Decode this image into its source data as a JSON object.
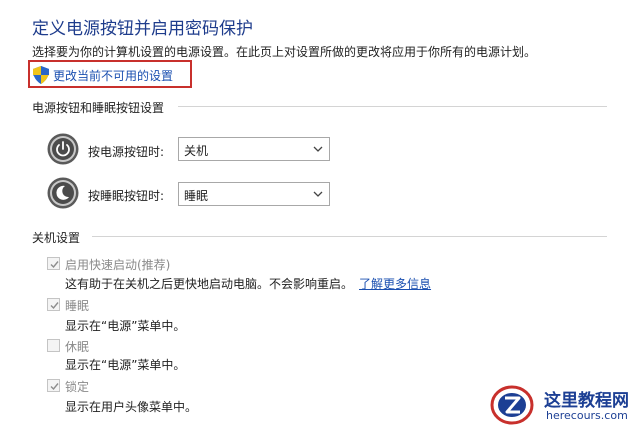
{
  "header": {
    "title": "定义电源按钮并启用密码保护",
    "description": "选择要为你的计算机设置的电源设置。在此页上对设置所做的更改将应用于你所有的电源计划。",
    "change_link": "更改当前不可用的设置"
  },
  "power_section": {
    "title": "电源按钮和睡眠按钮设置",
    "rows": [
      {
        "label": "按电源按钮时:",
        "value": "关机",
        "icon": "power-button-icon"
      },
      {
        "label": "按睡眠按钮时:",
        "value": "睡眠",
        "icon": "sleep-button-icon"
      }
    ]
  },
  "shutdown_section": {
    "title": "关机设置",
    "items": [
      {
        "label": "启用快速启动(推荐)",
        "checked": true,
        "desc": "这有助于在关机之后更快地启动电脑。不会影响重启。",
        "link": "了解更多信息"
      },
      {
        "label": "睡眠",
        "checked": true,
        "desc": "显示在“电源”菜单中。"
      },
      {
        "label": "休眠",
        "checked": false,
        "desc": "显示在“电源”菜单中。"
      },
      {
        "label": "锁定",
        "checked": true,
        "desc": "显示在用户头像菜单中。"
      }
    ]
  },
  "watermark": {
    "name": "这里教程网",
    "url": "herecours.com"
  },
  "colors": {
    "title": "#1e3c8c",
    "link": "#1a4fb0",
    "highlight_box": "#c8302c"
  }
}
